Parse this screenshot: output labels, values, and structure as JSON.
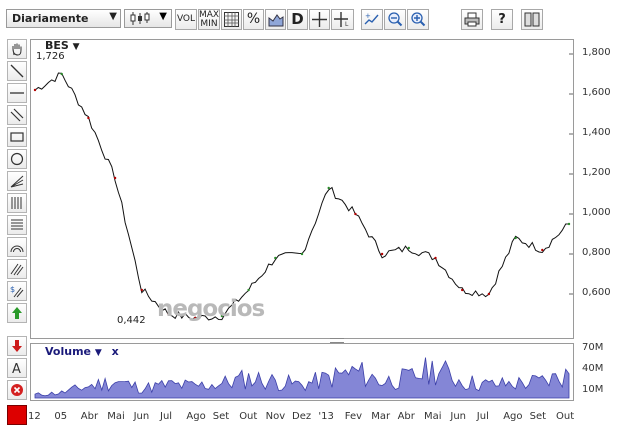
{
  "toolbar": {
    "period": "Diariamente",
    "vol_label": "VOL",
    "maxmin_label_1": "MAX",
    "maxmin_label_2": "MIN",
    "percent_label": "%",
    "d_label": "D",
    "help_label": "?"
  },
  "chart": {
    "symbol": "BES",
    "symbol_arrow": "▼",
    "max_label": "1,726",
    "min_label": "0,442",
    "watermark": "negocios",
    "price_color": "#111111",
    "up_color": "#2a8a2a",
    "down_color": "#b30000",
    "volume_color": "#3b3fa8",
    "volume_fill": "#8486d6"
  },
  "volume_panel": {
    "title": "Volume",
    "arrow": "▼",
    "close": "x"
  },
  "y_axis_price": [
    "1,800",
    "1,600",
    "1,400",
    "1,200",
    "1,000",
    "0,800",
    "0,600"
  ],
  "y_axis_volume": [
    "70M",
    "40M",
    "10M"
  ],
  "x_axis": [
    "12",
    "05",
    "Abr",
    "Mai",
    "Jun",
    "Jul",
    "Ago",
    "Set",
    "Out",
    "Nov",
    "Dez",
    "'13",
    "Fev",
    "Mar",
    "Abr",
    "Mai",
    "Jun",
    "Jul",
    "Ago",
    "Set",
    "Out"
  ],
  "chart_data": {
    "type": "line",
    "title": "BES",
    "xlabel": "",
    "ylabel": "",
    "ylim": [
      0.4,
      1.85
    ],
    "x": [
      "12",
      "05",
      "Abr",
      "Mai",
      "Jun",
      "Jul",
      "Ago",
      "Set",
      "Out",
      "Nov",
      "Dez",
      "'13",
      "Fev",
      "Mar",
      "Abr",
      "Mai",
      "Jun",
      "Jul",
      "Ago",
      "Set",
      "Out"
    ],
    "series": [
      {
        "values": [
          1.62,
          1.7,
          1.48,
          1.18,
          0.62,
          0.5,
          0.48,
          0.49,
          0.62,
          0.78,
          0.8,
          1.13,
          1.0,
          0.8,
          0.83,
          0.78,
          0.62,
          0.6,
          0.88,
          0.82,
          0.95
        ]
      }
    ],
    "volume": {
      "ylim": [
        0,
        75
      ],
      "values": [
        5,
        8,
        18,
        25,
        15,
        20,
        18,
        22,
        30,
        25,
        20,
        30,
        40,
        25,
        30,
        45,
        25,
        20,
        22,
        25,
        35
      ]
    }
  }
}
